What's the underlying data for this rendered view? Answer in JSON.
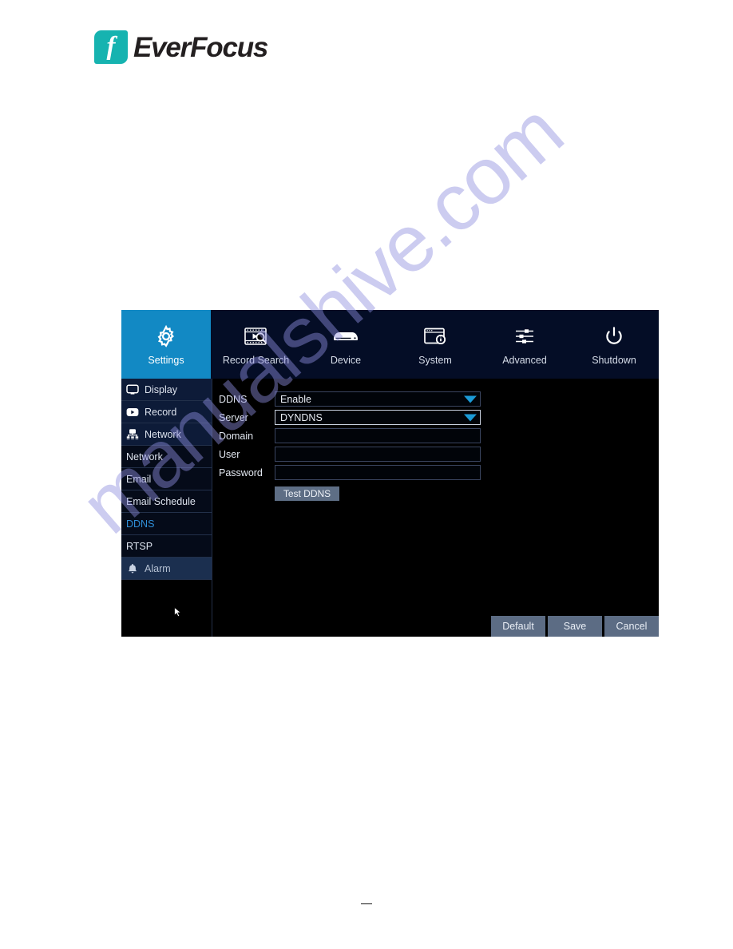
{
  "brand": {
    "logo_letter": "f",
    "logo_text": "EverFocus"
  },
  "watermark": {
    "text": "manualshive.com",
    "color": "#8f8fe0"
  },
  "colors": {
    "accent": "#1289c4",
    "header_bg": "#040d26",
    "panel_bg": "#000000",
    "selected_text": "#2f8fd8",
    "button_bg": "#5c6c84",
    "caret": "#1b9ad6"
  },
  "top_nav": {
    "tabs": [
      {
        "label": "Settings",
        "icon": "gear-icon",
        "active": true
      },
      {
        "label": "Record Search",
        "icon": "record-search-icon",
        "active": false
      },
      {
        "label": "Device",
        "icon": "device-icon",
        "active": false
      },
      {
        "label": "System",
        "icon": "system-info-icon",
        "active": false
      },
      {
        "label": "Advanced",
        "icon": "sliders-icon",
        "active": false
      },
      {
        "label": "Shutdown",
        "icon": "power-icon",
        "active": false
      }
    ]
  },
  "sidebar": {
    "items": [
      {
        "label": "Display",
        "icon": "monitor-icon",
        "type": "group",
        "state": "normal"
      },
      {
        "label": "Record",
        "icon": "play-icon",
        "type": "group",
        "state": "normal"
      },
      {
        "label": "Network",
        "icon": "network-icon",
        "type": "group",
        "state": "normal"
      },
      {
        "label": "Network",
        "icon": "",
        "type": "sub",
        "state": "normal"
      },
      {
        "label": "Email",
        "icon": "",
        "type": "sub",
        "state": "normal"
      },
      {
        "label": "Email Schedule",
        "icon": "",
        "type": "sub",
        "state": "normal"
      },
      {
        "label": "DDNS",
        "icon": "",
        "type": "sub",
        "state": "selected"
      },
      {
        "label": "RTSP",
        "icon": "",
        "type": "sub",
        "state": "normal"
      },
      {
        "label": "Alarm",
        "icon": "bell-icon",
        "type": "group",
        "state": "hover"
      }
    ]
  },
  "form": {
    "rows": [
      {
        "label": "DDNS",
        "value": "Enable",
        "control": "dropdown",
        "focused": false
      },
      {
        "label": "Server",
        "value": "DYNDNS",
        "control": "dropdown",
        "focused": true
      },
      {
        "label": "Domain",
        "value": "",
        "control": "text",
        "focused": false
      },
      {
        "label": "User",
        "value": "",
        "control": "text",
        "focused": false
      },
      {
        "label": "Password",
        "value": "",
        "control": "password",
        "focused": false
      }
    ],
    "test_button_label": "Test DDNS"
  },
  "footer": {
    "buttons": [
      {
        "label": "Default"
      },
      {
        "label": "Save"
      },
      {
        "label": "Cancel"
      }
    ]
  },
  "page_footer": {
    "dash": "—"
  }
}
